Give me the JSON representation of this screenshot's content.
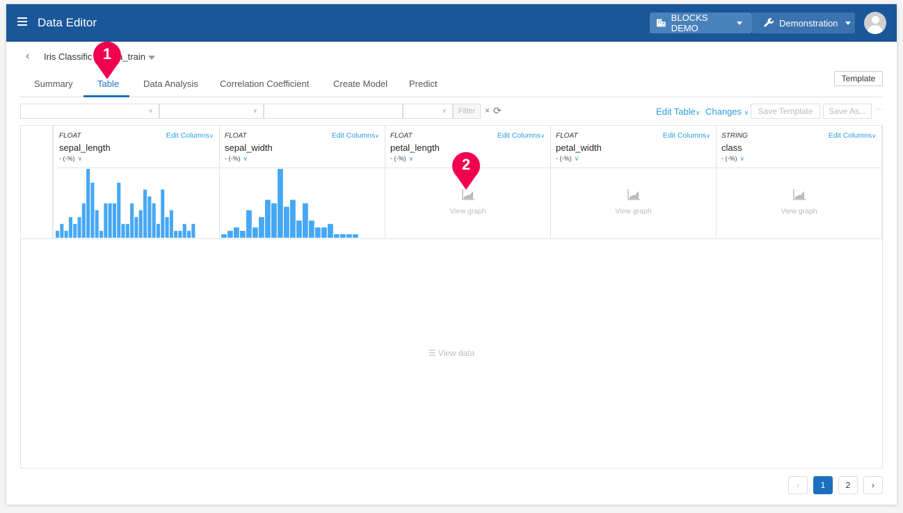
{
  "header": {
    "app_title": "Data Editor",
    "menu_icon": "hamburger-icon",
    "org": {
      "label": "BLOCKS DEMO",
      "icon": "building-icon"
    },
    "project": {
      "label": "Demonstration",
      "icon": "wrench-icon"
    },
    "avatar_icon": "user-avatar-icon",
    "brand_color": "#1a5799"
  },
  "breadcrumb": {
    "back_icon": "chevron-left-icon",
    "dataset": "Iris Classification_data_train",
    "dataset_visible_start": "Iris Classific",
    "dataset_visible_end": "ata_train"
  },
  "tabs": [
    {
      "label": "Summary",
      "active": false
    },
    {
      "label": "Table",
      "active": true
    },
    {
      "label": "Data Analysis",
      "active": false
    },
    {
      "label": "Correlation Coefficient",
      "active": false
    },
    {
      "label": "Create Model",
      "active": false
    },
    {
      "label": "Predict",
      "active": false
    }
  ],
  "template_button": "Template",
  "filter": {
    "selects": [
      "",
      "",
      "",
      ""
    ],
    "filter_button": "Filter",
    "clear_icon": "×",
    "refresh_icon": "refresh-icon"
  },
  "toolbar": {
    "edit_table": "Edit Table",
    "changes": "Changes",
    "save_template": "Save Template",
    "save_as": "Save As...",
    "more": "···"
  },
  "columns": [
    {
      "type": "FLOAT",
      "name": "sepal_length",
      "stat": "- (-%)",
      "edit": "Edit Columns",
      "histogram": [
        1,
        2,
        1,
        3,
        2,
        3,
        5,
        10,
        8,
        4,
        1,
        5,
        5,
        5,
        8,
        2,
        2,
        5,
        3,
        4,
        7,
        6,
        5,
        2,
        7,
        3,
        4,
        1,
        1,
        2,
        1,
        2
      ],
      "view_graph": null
    },
    {
      "type": "FLOAT",
      "name": "sepal_width",
      "stat": "- (-%)",
      "edit": "Edit Columns",
      "histogram": [
        1,
        2,
        3,
        2,
        8,
        3,
        6,
        11,
        10,
        20,
        9,
        11,
        5,
        10,
        5,
        3,
        3,
        4,
        1,
        1,
        1,
        1
      ],
      "view_graph": null
    },
    {
      "type": "FLOAT",
      "name": "petal_length",
      "stat": "- (-%)",
      "edit": "Edit Columns",
      "histogram": null,
      "view_graph": "View graph"
    },
    {
      "type": "FLOAT",
      "name": "petal_width",
      "stat": "- (-%)",
      "edit": "Edit Columns",
      "histogram": null,
      "view_graph": "View graph"
    },
    {
      "type": "STRING",
      "name": "class",
      "stat": "- (-%)",
      "edit": "Edit Columns",
      "histogram": null,
      "view_graph": "View graph"
    }
  ],
  "view_data": "View data",
  "pagination": {
    "prev": "‹",
    "pages": [
      "1",
      "2"
    ],
    "current": "1",
    "next": "›"
  },
  "markers": [
    {
      "number": "1",
      "target": "Table tab"
    },
    {
      "number": "2",
      "target": "petal_length View graph"
    }
  ],
  "colors": {
    "accent": "#2a9ce0",
    "bar": "#46a8f5",
    "marker": "#f0004f",
    "page_active": "#1c6fbe"
  }
}
